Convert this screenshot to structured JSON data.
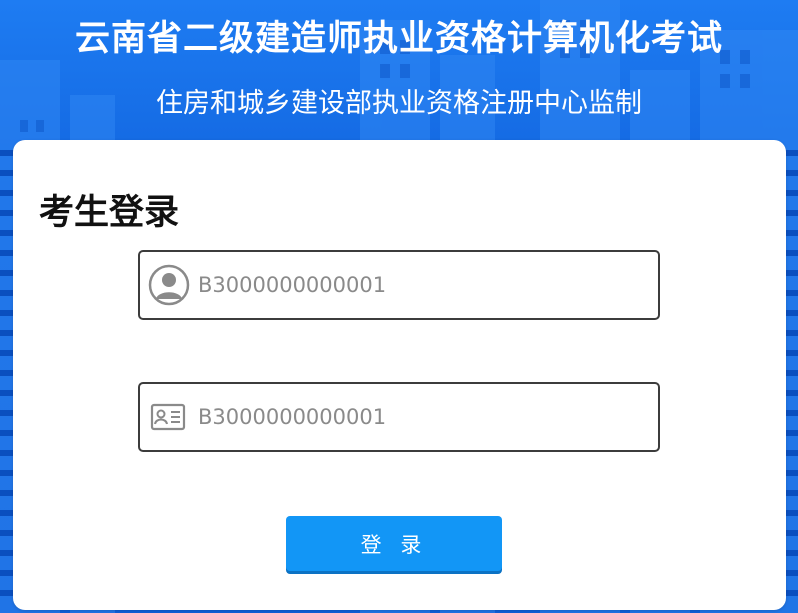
{
  "header": {
    "title": "云南省二级建造师执业资格计算机化考试",
    "subtitle": "住房和城乡建设部执业资格注册中心监制"
  },
  "login": {
    "heading": "考生登录",
    "id_field": {
      "icon": "user-avatar-icon",
      "placeholder": "B3000000000001"
    },
    "card_field": {
      "icon": "id-card-icon",
      "placeholder": "B3000000000001"
    },
    "submit_label": "登 录"
  },
  "colors": {
    "background_blue": "#1266e0",
    "button_blue": "#1296f6",
    "card_white": "#ffffff",
    "field_border": "#3c3c3c",
    "placeholder_gray": "#8a8a8a"
  }
}
